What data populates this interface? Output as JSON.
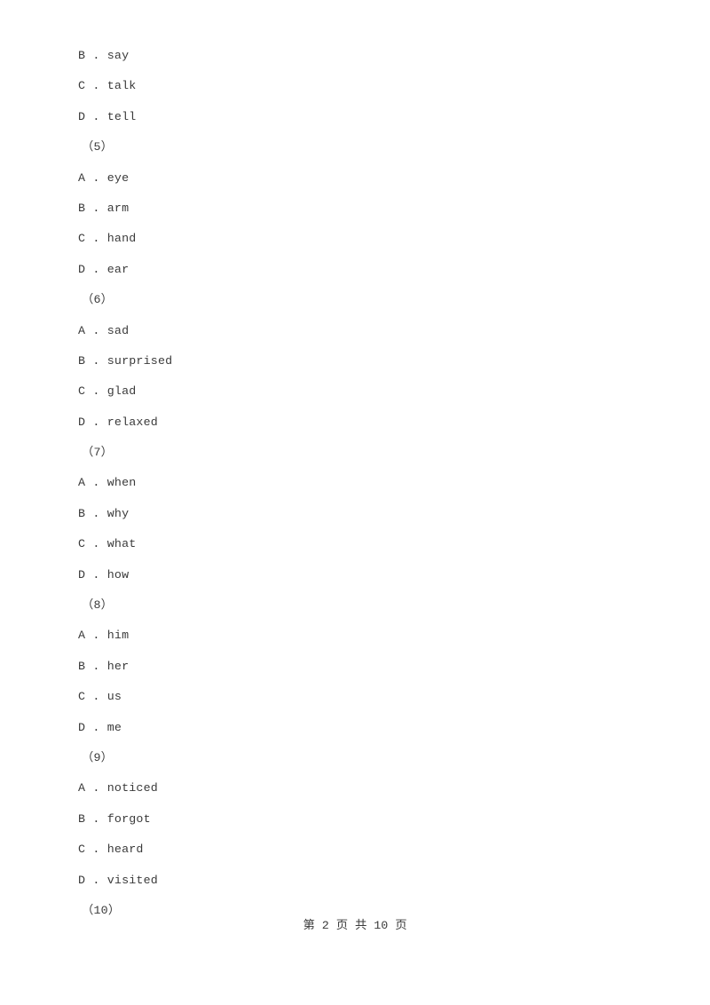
{
  "document": {
    "type": "exam-worksheet",
    "background_color": "#ffffff",
    "text_color": "#3a3a3a",
    "lines": [
      {
        "kind": "option",
        "text": "B . say"
      },
      {
        "kind": "option",
        "text": "C . talk"
      },
      {
        "kind": "option",
        "text": "D . tell"
      },
      {
        "kind": "question-number",
        "text": "（5）"
      },
      {
        "kind": "option",
        "text": "A . eye"
      },
      {
        "kind": "option",
        "text": "B . arm"
      },
      {
        "kind": "option",
        "text": "C . hand"
      },
      {
        "kind": "option",
        "text": "D . ear"
      },
      {
        "kind": "question-number",
        "text": "（6）"
      },
      {
        "kind": "option",
        "text": "A . sad"
      },
      {
        "kind": "option",
        "text": "B . surprised"
      },
      {
        "kind": "option",
        "text": "C . glad"
      },
      {
        "kind": "option",
        "text": "D . relaxed"
      },
      {
        "kind": "question-number",
        "text": "（7）"
      },
      {
        "kind": "option",
        "text": "A . when"
      },
      {
        "kind": "option",
        "text": "B . why"
      },
      {
        "kind": "option",
        "text": "C . what"
      },
      {
        "kind": "option",
        "text": "D . how"
      },
      {
        "kind": "question-number",
        "text": "（8）"
      },
      {
        "kind": "option",
        "text": "A . him"
      },
      {
        "kind": "option",
        "text": "B . her"
      },
      {
        "kind": "option",
        "text": "C . us"
      },
      {
        "kind": "option",
        "text": "D . me"
      },
      {
        "kind": "question-number",
        "text": "（9）"
      },
      {
        "kind": "option",
        "text": "A . noticed"
      },
      {
        "kind": "option",
        "text": "B . forgot"
      },
      {
        "kind": "option",
        "text": "C . heard"
      },
      {
        "kind": "option",
        "text": "D . visited"
      },
      {
        "kind": "question-number",
        "text": "（10）"
      }
    ]
  },
  "footer": {
    "text": "第 2 页 共 10 页",
    "current_page": 2,
    "total_pages": 10
  }
}
